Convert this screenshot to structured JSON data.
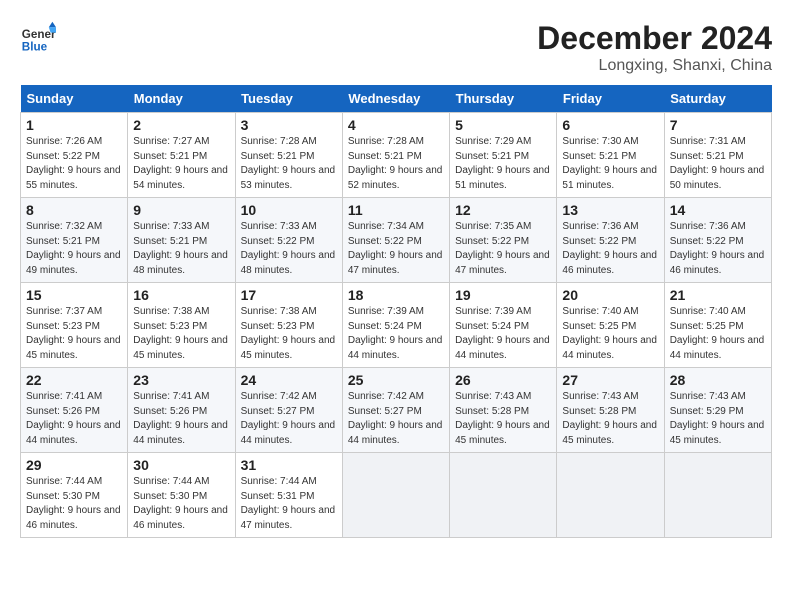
{
  "header": {
    "logo_line1": "General",
    "logo_line2": "Blue",
    "month": "December 2024",
    "location": "Longxing, Shanxi, China"
  },
  "days_of_week": [
    "Sunday",
    "Monday",
    "Tuesday",
    "Wednesday",
    "Thursday",
    "Friday",
    "Saturday"
  ],
  "weeks": [
    [
      {
        "day": "1",
        "rise": "7:26 AM",
        "set": "5:22 PM",
        "daylight": "9 hours and 55 minutes."
      },
      {
        "day": "2",
        "rise": "7:27 AM",
        "set": "5:21 PM",
        "daylight": "9 hours and 54 minutes."
      },
      {
        "day": "3",
        "rise": "7:28 AM",
        "set": "5:21 PM",
        "daylight": "9 hours and 53 minutes."
      },
      {
        "day": "4",
        "rise": "7:28 AM",
        "set": "5:21 PM",
        "daylight": "9 hours and 52 minutes."
      },
      {
        "day": "5",
        "rise": "7:29 AM",
        "set": "5:21 PM",
        "daylight": "9 hours and 51 minutes."
      },
      {
        "day": "6",
        "rise": "7:30 AM",
        "set": "5:21 PM",
        "daylight": "9 hours and 51 minutes."
      },
      {
        "day": "7",
        "rise": "7:31 AM",
        "set": "5:21 PM",
        "daylight": "9 hours and 50 minutes."
      }
    ],
    [
      {
        "day": "8",
        "rise": "7:32 AM",
        "set": "5:21 PM",
        "daylight": "9 hours and 49 minutes."
      },
      {
        "day": "9",
        "rise": "7:33 AM",
        "set": "5:21 PM",
        "daylight": "9 hours and 48 minutes."
      },
      {
        "day": "10",
        "rise": "7:33 AM",
        "set": "5:22 PM",
        "daylight": "9 hours and 48 minutes."
      },
      {
        "day": "11",
        "rise": "7:34 AM",
        "set": "5:22 PM",
        "daylight": "9 hours and 47 minutes."
      },
      {
        "day": "12",
        "rise": "7:35 AM",
        "set": "5:22 PM",
        "daylight": "9 hours and 47 minutes."
      },
      {
        "day": "13",
        "rise": "7:36 AM",
        "set": "5:22 PM",
        "daylight": "9 hours and 46 minutes."
      },
      {
        "day": "14",
        "rise": "7:36 AM",
        "set": "5:22 PM",
        "daylight": "9 hours and 46 minutes."
      }
    ],
    [
      {
        "day": "15",
        "rise": "7:37 AM",
        "set": "5:23 PM",
        "daylight": "9 hours and 45 minutes."
      },
      {
        "day": "16",
        "rise": "7:38 AM",
        "set": "5:23 PM",
        "daylight": "9 hours and 45 minutes."
      },
      {
        "day": "17",
        "rise": "7:38 AM",
        "set": "5:23 PM",
        "daylight": "9 hours and 45 minutes."
      },
      {
        "day": "18",
        "rise": "7:39 AM",
        "set": "5:24 PM",
        "daylight": "9 hours and 44 minutes."
      },
      {
        "day": "19",
        "rise": "7:39 AM",
        "set": "5:24 PM",
        "daylight": "9 hours and 44 minutes."
      },
      {
        "day": "20",
        "rise": "7:40 AM",
        "set": "5:25 PM",
        "daylight": "9 hours and 44 minutes."
      },
      {
        "day": "21",
        "rise": "7:40 AM",
        "set": "5:25 PM",
        "daylight": "9 hours and 44 minutes."
      }
    ],
    [
      {
        "day": "22",
        "rise": "7:41 AM",
        "set": "5:26 PM",
        "daylight": "9 hours and 44 minutes."
      },
      {
        "day": "23",
        "rise": "7:41 AM",
        "set": "5:26 PM",
        "daylight": "9 hours and 44 minutes."
      },
      {
        "day": "24",
        "rise": "7:42 AM",
        "set": "5:27 PM",
        "daylight": "9 hours and 44 minutes."
      },
      {
        "day": "25",
        "rise": "7:42 AM",
        "set": "5:27 PM",
        "daylight": "9 hours and 44 minutes."
      },
      {
        "day": "26",
        "rise": "7:43 AM",
        "set": "5:28 PM",
        "daylight": "9 hours and 45 minutes."
      },
      {
        "day": "27",
        "rise": "7:43 AM",
        "set": "5:28 PM",
        "daylight": "9 hours and 45 minutes."
      },
      {
        "day": "28",
        "rise": "7:43 AM",
        "set": "5:29 PM",
        "daylight": "9 hours and 45 minutes."
      }
    ],
    [
      {
        "day": "29",
        "rise": "7:44 AM",
        "set": "5:30 PM",
        "daylight": "9 hours and 46 minutes."
      },
      {
        "day": "30",
        "rise": "7:44 AM",
        "set": "5:30 PM",
        "daylight": "9 hours and 46 minutes."
      },
      {
        "day": "31",
        "rise": "7:44 AM",
        "set": "5:31 PM",
        "daylight": "9 hours and 47 minutes."
      },
      null,
      null,
      null,
      null
    ]
  ]
}
